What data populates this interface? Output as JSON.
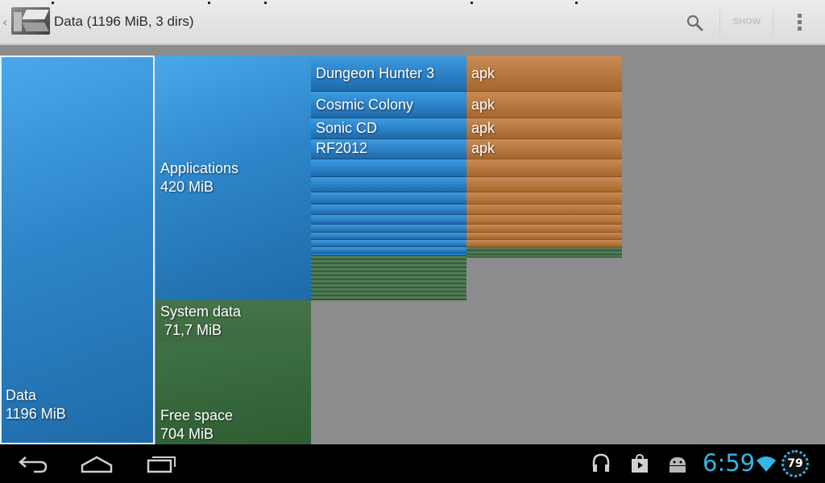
{
  "action_bar": {
    "title": "Data (1196 MiB, 3 dirs)",
    "show_label": "SHOW",
    "icons": [
      "up-chevron",
      "app-icon",
      "search-icon",
      "overflow-menu-icon"
    ]
  },
  "treemap": {
    "root": {
      "label": "Data\n1196 MiB"
    },
    "applications": {
      "label": "Applications\n420 MiB"
    },
    "system_data": {
      "label": "System data\n 71,7 MiB"
    },
    "free_space": {
      "label": "Free space\n704 MiB"
    },
    "apps": [
      {
        "name": "Dungeon Hunter 3",
        "type": "apk"
      },
      {
        "name": "Cosmic Colony",
        "type": "apk"
      },
      {
        "name": "Sonic CD",
        "type": "apk"
      },
      {
        "name": "RF2012",
        "type": "apk"
      }
    ],
    "colors": {
      "data_blue": "#2d86c9",
      "system_green": "#3e6b42",
      "apk_wood": "#b7773f",
      "background": "#8c8b8d"
    }
  },
  "system_bar": {
    "clock": "6:59",
    "battery": "79",
    "icons": [
      "back-icon",
      "home-icon",
      "recent-apps-icon",
      "headphones-icon",
      "play-store-icon",
      "android-icon",
      "wifi-icon",
      "battery-icon"
    ],
    "accent": "#33b5e5"
  }
}
